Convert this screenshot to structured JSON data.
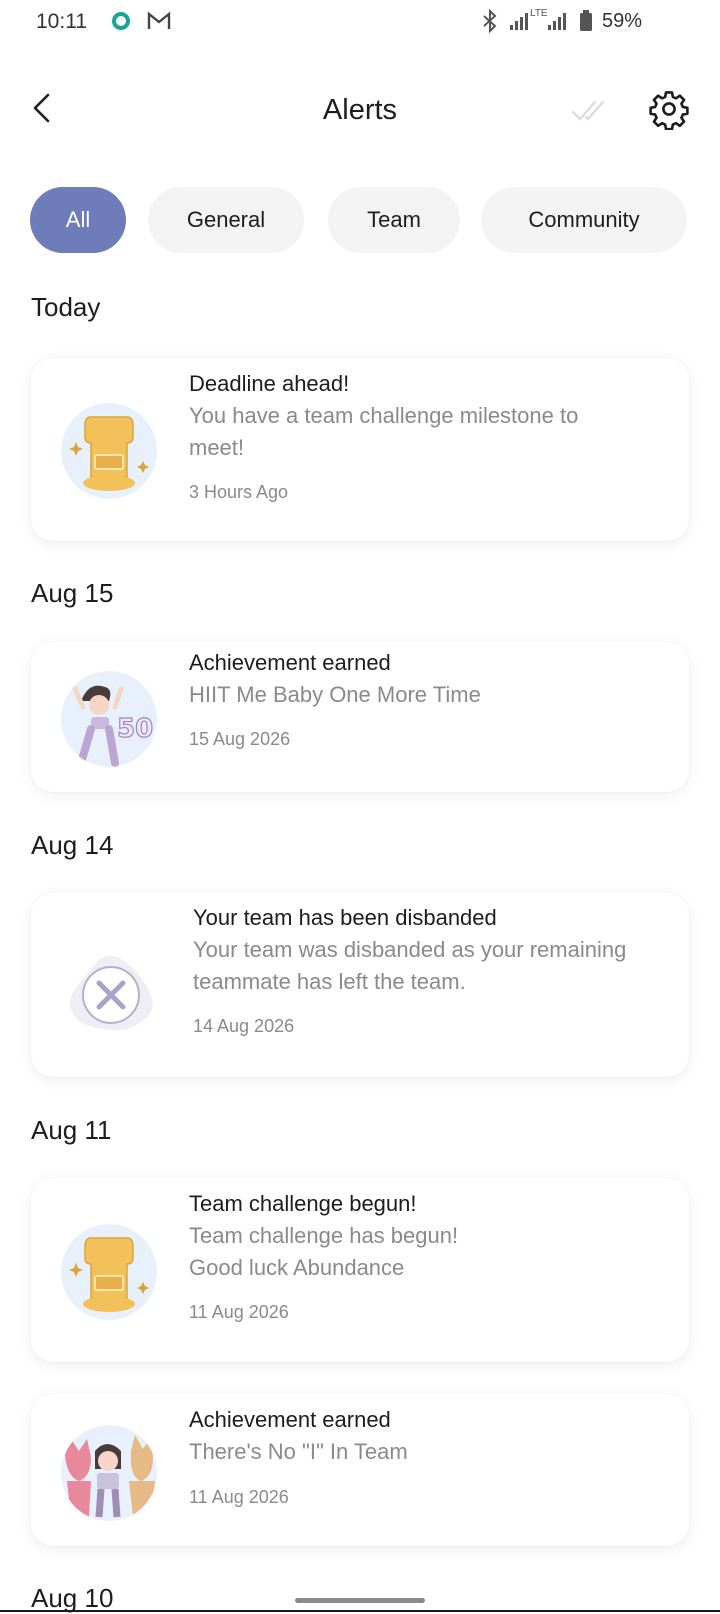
{
  "status_bar": {
    "time": "10:11",
    "battery": "59%",
    "network": "LTE"
  },
  "header": {
    "title": "Alerts"
  },
  "filters": [
    {
      "label": "All",
      "active": true
    },
    {
      "label": "General",
      "active": false
    },
    {
      "label": "Team",
      "active": false
    },
    {
      "label": "Community",
      "active": false
    }
  ],
  "sections": [
    {
      "label": "Today"
    },
    {
      "label": "Aug 15"
    },
    {
      "label": "Aug 14"
    },
    {
      "label": "Aug 11"
    },
    {
      "label": "Aug 10"
    }
  ],
  "alerts": [
    {
      "title": "Deadline ahead!",
      "body": "You have a team challenge milestone to meet!",
      "date": "3 Hours Ago",
      "icon": "trophy-icon"
    },
    {
      "title": "Achievement earned",
      "body": "HIIT Me Baby One More Time",
      "date": "15 Aug 2026",
      "icon": "hiit-badge-icon",
      "badge_number": "50"
    },
    {
      "title": "Your team has been disbanded",
      "body": "Your team was disbanded as your remaining teammate has left the team.",
      "date": "14 Aug 2026",
      "icon": "disbanded-icon"
    },
    {
      "title": "Team challenge begun!",
      "body": "Team challenge has begun! Good luck Abundance",
      "date": "11 Aug 2026",
      "icon": "trophy-icon"
    },
    {
      "title": "Achievement earned",
      "body": "There's No \"I\" In Team",
      "date": "11 Aug 2026",
      "icon": "team-badge-icon"
    }
  ],
  "colors": {
    "accent": "#6f7cba",
    "chip_bg": "#f3f3f4",
    "muted_text": "#8a8a8e",
    "trophy": "#f2c15a"
  }
}
